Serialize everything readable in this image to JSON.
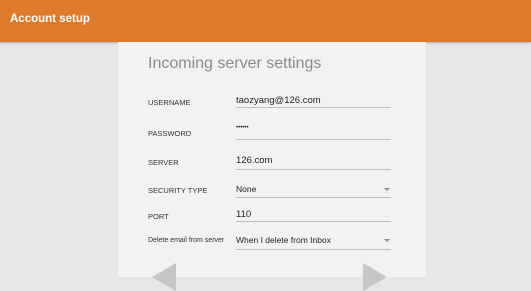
{
  "app_bar": {
    "title": "Account setup",
    "color": "#e07a2b"
  },
  "form": {
    "heading": "Incoming server settings",
    "fields": [
      {
        "label": "USERNAME",
        "value": "taozyang@126.com",
        "type": "text"
      },
      {
        "label": "PASSWORD",
        "value": "••••••",
        "type": "password"
      },
      {
        "label": "SERVER",
        "value": "126.com",
        "type": "text"
      },
      {
        "label": "SECURITY TYPE",
        "value": "None",
        "type": "dropdown"
      },
      {
        "label": "PORT",
        "value": "110",
        "type": "text"
      },
      {
        "label": "Delete email from server",
        "value": "When I delete from Inbox",
        "type": "dropdown"
      }
    ]
  },
  "navigation": {
    "prev_icon": "triangle-left-icon",
    "next_icon": "triangle-right-icon"
  }
}
